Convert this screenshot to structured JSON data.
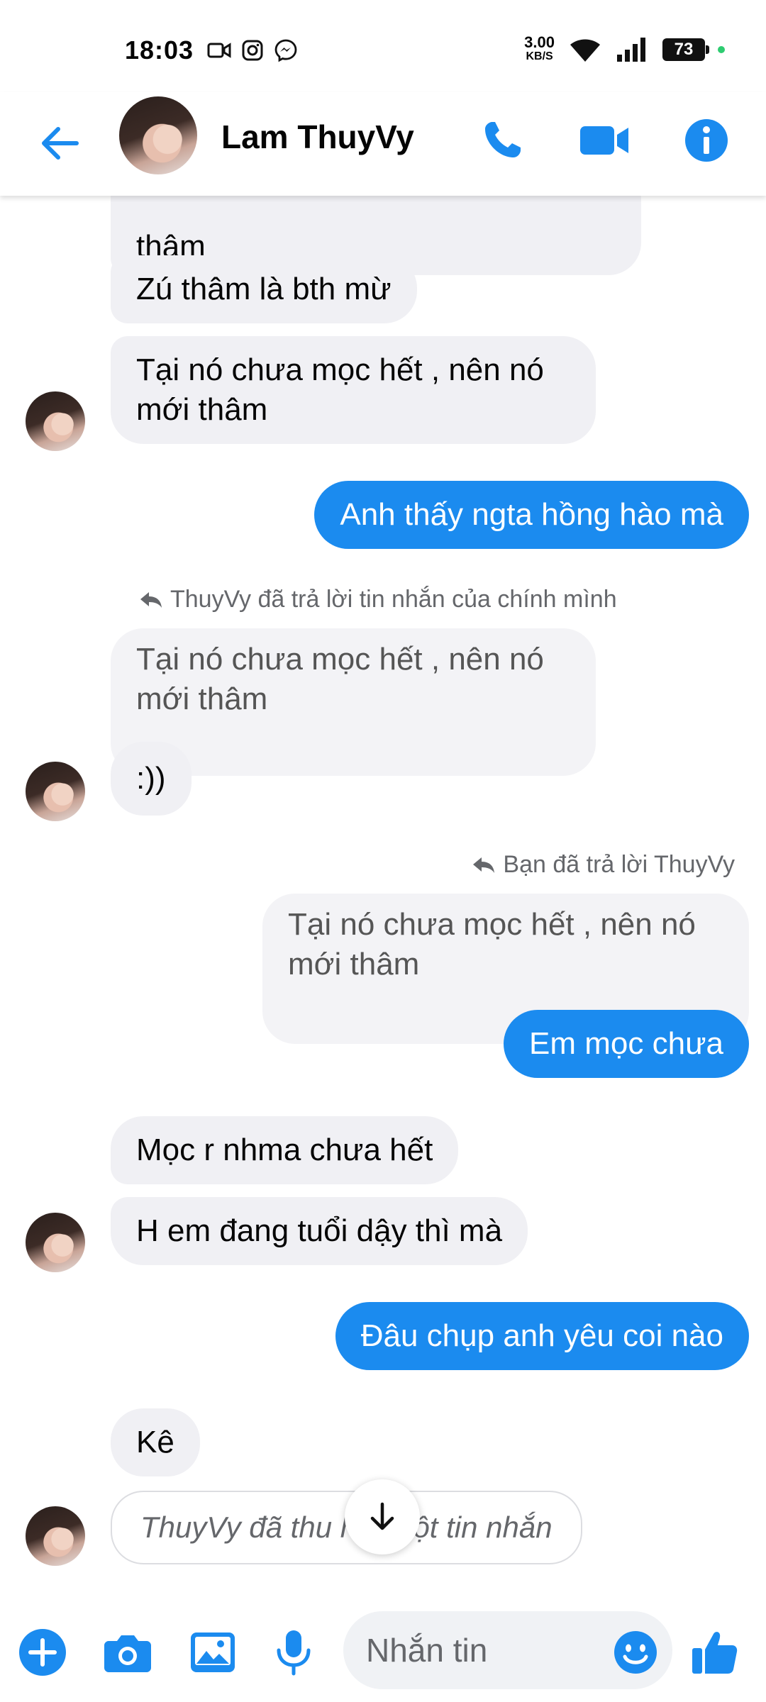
{
  "status_bar": {
    "time": "18:03",
    "net_speed_value": "3.00",
    "net_speed_unit": "KB/S",
    "battery": "73"
  },
  "header": {
    "contact_name": "Lam ThuyVy",
    "accent": "#1b8bef"
  },
  "messages": {
    "m0": "thâm",
    "m1": "Zú thâm là bth mừ",
    "m2": "Tại nó chưa mọc hết , nên nó mới thâm",
    "m3": "Anh thấy ngta hồng hào mà",
    "reply1_meta": "ThuyVy đã trả lời tin nhắn của chính mình",
    "reply1_quote": "Tại nó chưa mọc hết , nên nó mới thâm",
    "m4": ":))",
    "reply2_meta": "Bạn đã trả lời ThuyVy",
    "reply2_quote": "Tại nó chưa mọc hết , nên nó mới thâm",
    "m5": "Em mọc chưa",
    "m6": "Mọc r nhma chưa hết",
    "m7": "H em đang tuổi dậy thì mà",
    "m8": "Đâu chụp anh yêu coi nào",
    "m9": "Kê",
    "unsent": "ThuyVy đã thu hồi một tin nhắn"
  },
  "composer": {
    "placeholder": "Nhắn tin"
  },
  "icons": {
    "back": "arrow-left-icon",
    "call": "phone-icon",
    "video": "video-camera-icon",
    "info": "info-icon",
    "add": "plus-circle-icon",
    "camera": "camera-icon",
    "gallery": "image-icon",
    "mic": "microphone-icon",
    "emoji": "smiley-icon",
    "like": "thumbs-up-icon"
  }
}
